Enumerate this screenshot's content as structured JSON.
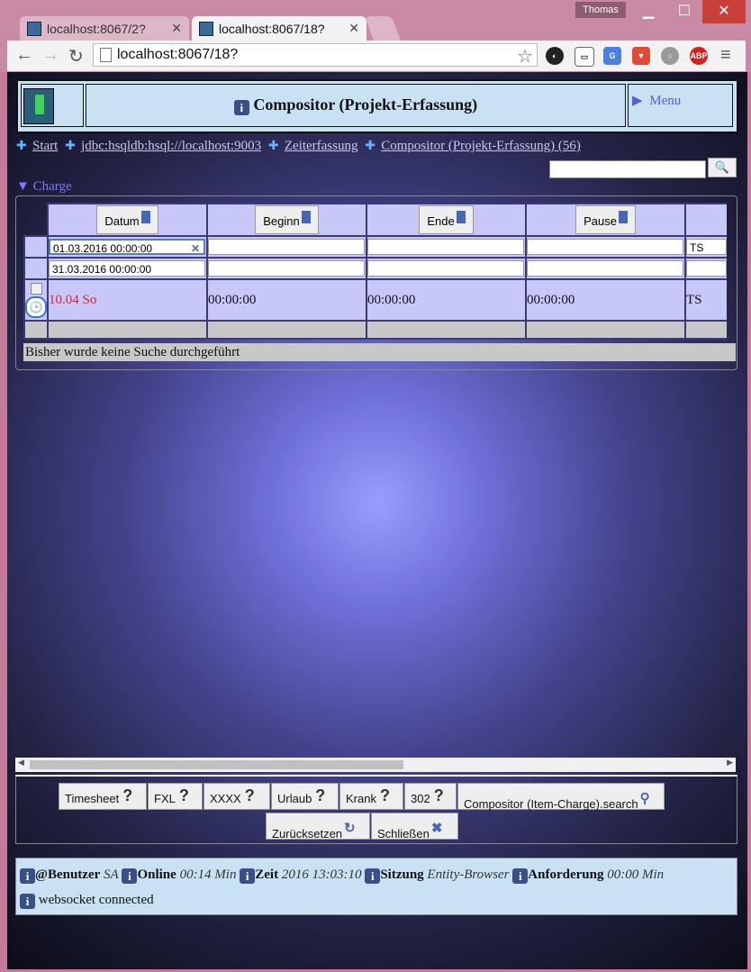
{
  "browser": {
    "tabs": [
      {
        "title": "localhost:8067/2?"
      },
      {
        "title": "localhost:8067/18?"
      }
    ],
    "user": "Thomas",
    "address": "localhost:8067/18?"
  },
  "header": {
    "title": "Compositor (Projekt-Erfassung)",
    "menu": "Menu"
  },
  "breadcrumb": [
    "Start",
    "jdbc:hsqldb:hsql://localhost:9003",
    "Zeiterfassung",
    "Compositor (Projekt-Erfassung) (56)"
  ],
  "section": "Charge",
  "grid": {
    "columns": [
      "Datum",
      "Beginn",
      "Ende",
      "Pause"
    ],
    "filter_from": "01.03.2016 00:00:00",
    "filter_to": "31.03.2016 00:00:00",
    "filter_extra": "TS",
    "row": {
      "datum": "10.04 So",
      "beginn": "00:00:00",
      "ende": "00:00:00",
      "pause": "00:00:00",
      "extra": "TS"
    },
    "status": "Bisher wurde keine Suche durchgeführt"
  },
  "buttons": {
    "timesheet": "Timesheet",
    "fxl": "FXL",
    "xxxx": "XXXX",
    "urlaub": "Urlaub",
    "krank": "Krank",
    "n302": "302",
    "search": "Compositor (Item-Charge).search",
    "reset": "Zurücksetzen",
    "close": "Schließen"
  },
  "footer": {
    "benutzer_label": "@Benutzer",
    "benutzer": "SA",
    "online_label": "Online",
    "online": "00:14 Min",
    "zeit_label": "Zeit",
    "zeit": "2016 13:03:10",
    "sitzung_label": "Sitzung",
    "sitzung": "Entity-Browser",
    "anforderung_label": "Anforderung",
    "anforderung": "00:00 Min",
    "websocket": "websocket connected"
  }
}
